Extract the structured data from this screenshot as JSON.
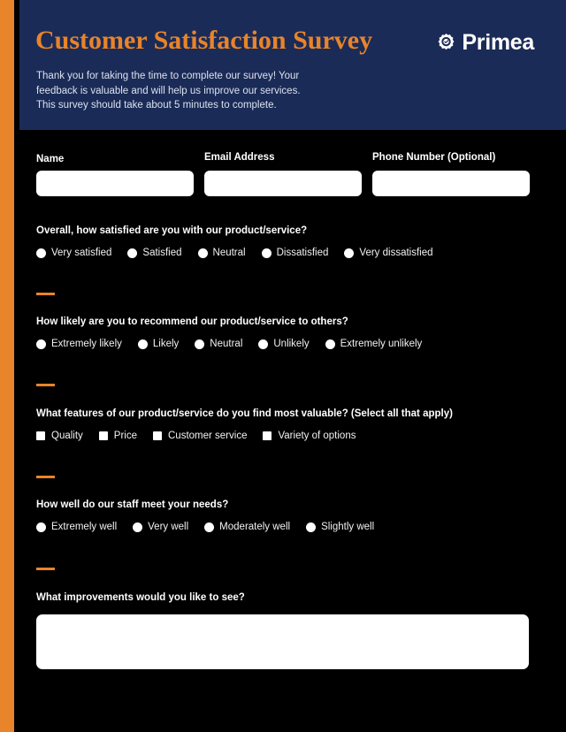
{
  "brand": {
    "name": "Primea",
    "mark_icon": "gear-check-icon"
  },
  "header": {
    "title": "Customer Satisfaction Survey",
    "intro_lines": [
      "Thank you for taking the time to complete our survey! Your",
      "feedback is valuable and will help us improve our services.",
      "This survey should take about 5 minutes to complete."
    ]
  },
  "colors": {
    "accent_orange": "#E8842A",
    "header_navy": "#1B2B57",
    "background": "#000000",
    "field_white": "#FFFFFF",
    "intro_text": "#DBE1EE"
  },
  "contact_fields": [
    {
      "label": "Name",
      "value": "",
      "placeholder": ""
    },
    {
      "label": "Email Address",
      "value": "",
      "placeholder": ""
    },
    {
      "label": "Phone Number (Optional)",
      "value": "",
      "placeholder": ""
    }
  ],
  "questions": [
    {
      "title": "Overall, how satisfied are you with our product/service?",
      "type": "radio",
      "options": [
        "Very satisfied",
        "Satisfied",
        "Neutral",
        "Dissatisfied",
        "Very dissatisfied"
      ]
    },
    {
      "title": "How likely are you to recommend our product/service to others?",
      "type": "radio",
      "options": [
        "Extremely likely",
        "Likely",
        "Neutral",
        "Unlikely",
        "Extremely unlikely"
      ]
    },
    {
      "title": "What features of our product/service do you find most valuable? (Select all that apply)",
      "type": "checkbox",
      "options": [
        "Quality",
        "Price",
        "Customer service",
        "Variety of options"
      ]
    },
    {
      "title": "How well do our staff meet your needs?",
      "type": "radio",
      "options": [
        "Extremely well",
        "Very well",
        "Moderately well",
        "Slightly well"
      ]
    },
    {
      "title": "What improvements would you like to see?",
      "type": "textarea",
      "value": "",
      "placeholder": ""
    }
  ]
}
